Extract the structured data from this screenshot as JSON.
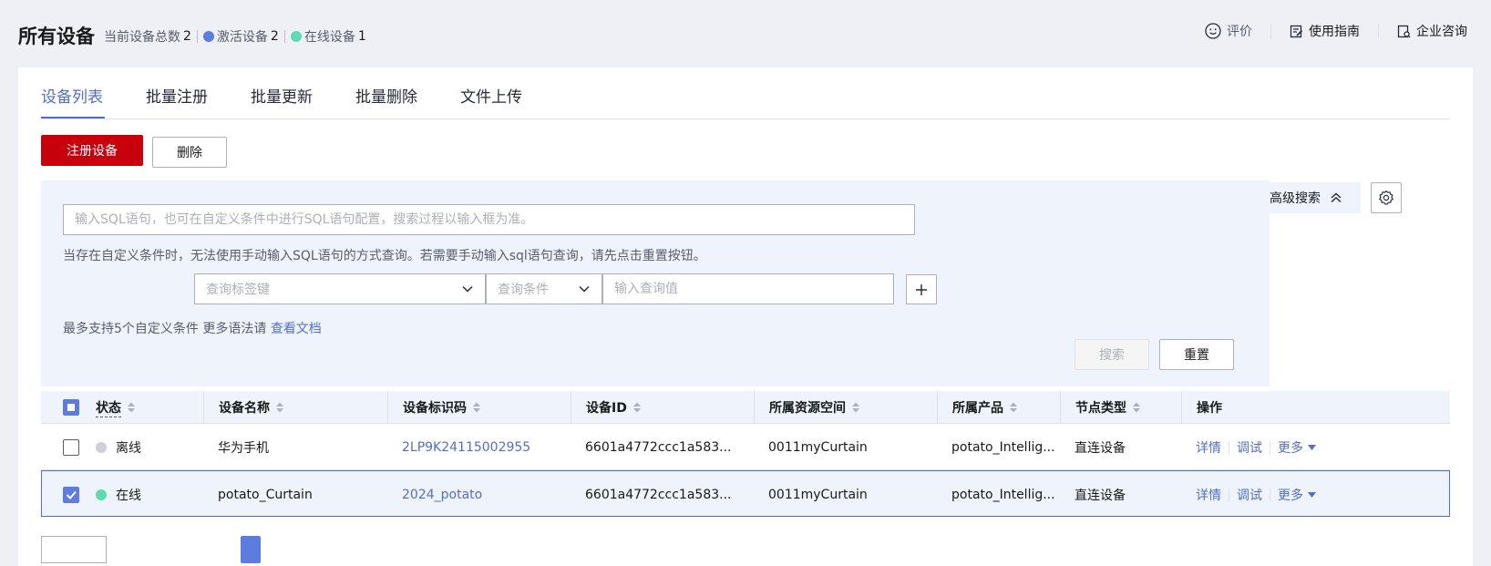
{
  "header": {
    "title": "所有设备",
    "total_label": "当前设备总数",
    "total_count": "2",
    "active_label": "激活设备",
    "active_count": "2",
    "online_label": "在线设备",
    "online_count": "1",
    "links": {
      "feedback": "评价",
      "guide": "使用指南",
      "consult": "企业咨询"
    }
  },
  "tabs": [
    "设备列表",
    "批量注册",
    "批量更新",
    "批量删除",
    "文件上传"
  ],
  "toolbar": {
    "register_label": "注册设备",
    "delete_label": "删除"
  },
  "search": {
    "sql_placeholder": "输入SQL语句，也可在自定义条件中进行SQL语句配置，搜索过程以输入框为准。",
    "hint": "当存在自定义条件时，无法使用手动输入SQL语句的方式查询。若需要手动输入sql语句查询，请先点击重置按钮。",
    "tag_key_placeholder": "查询标签键",
    "condition_placeholder": "查询条件",
    "value_placeholder": "输入查询值",
    "max_note": "最多支持5个自定义条件 更多语法请",
    "doc_link": "查看文档",
    "search_label": "搜索",
    "reset_label": "重置",
    "advanced_label": "高级搜索"
  },
  "table": {
    "columns": [
      "状态",
      "设备名称",
      "设备标识码",
      "设备ID",
      "所属资源空间",
      "所属产品",
      "节点类型",
      "操作"
    ],
    "rows": [
      {
        "checked": false,
        "status": "离线",
        "status_color": "#cdd0d6",
        "name": "华为手机",
        "node_id": "2LP9K24115002955",
        "device_id": "6601a4772ccc1a583...",
        "space": "0011myCurtain",
        "product": "potato_Intellig...",
        "node_type": "直连设备"
      },
      {
        "checked": true,
        "status": "在线",
        "status_color": "#5fdbb4",
        "name": "potato_Curtain",
        "node_id": "2024_potato",
        "device_id": "6601a4772ccc1a583...",
        "space": "0011myCurtain",
        "product": "potato_Intellig...",
        "node_type": "直连设备"
      }
    ],
    "ops": {
      "detail": "详情",
      "debug": "调试",
      "more": "更多"
    }
  },
  "colors": {
    "primary": "#c7000b",
    "link": "#526ecc",
    "accent": "#5e7ce0",
    "online": "#5fdbb4",
    "offline": "#cdd0d6"
  }
}
